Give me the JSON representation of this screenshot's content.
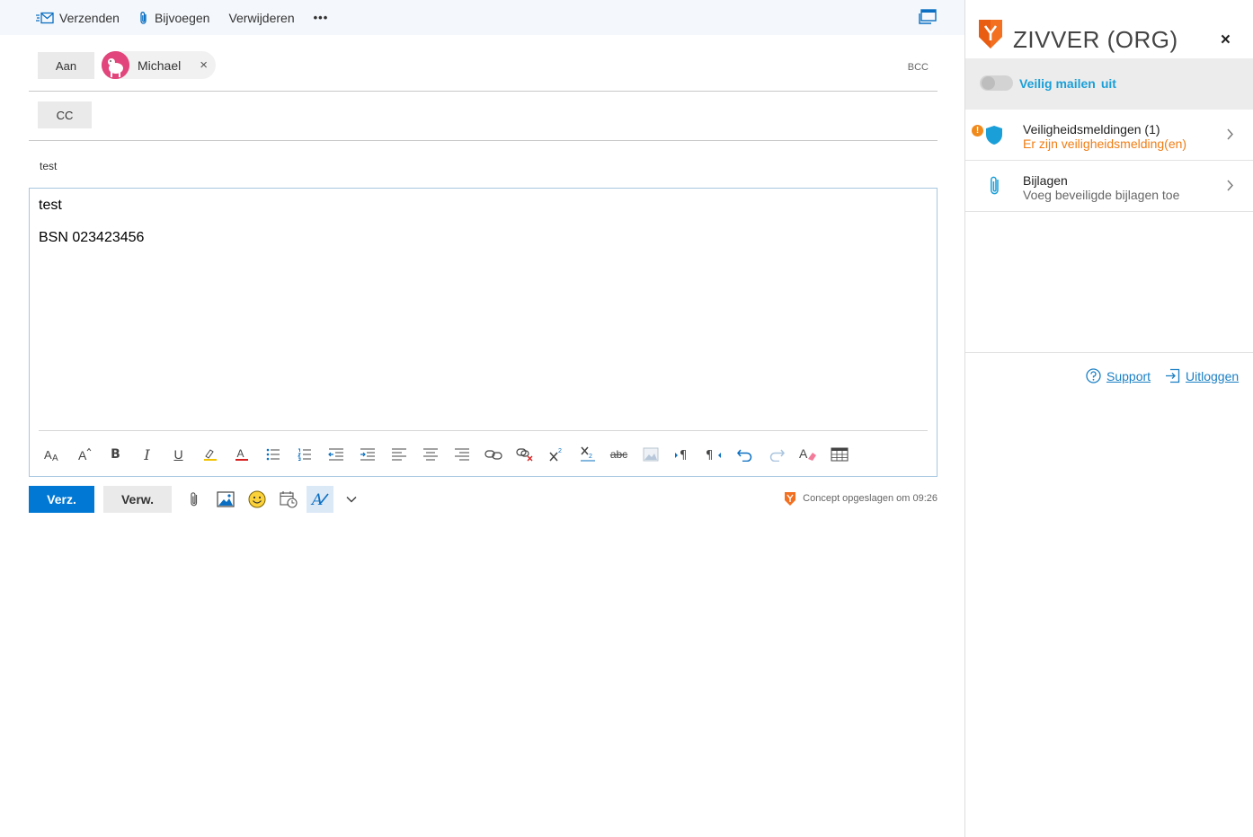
{
  "command_bar": {
    "send_label": "Verzenden",
    "attach_label": "Bijvoegen",
    "delete_label": "Verwijderen",
    "more_label": "•••"
  },
  "recipients": {
    "to_label": "Aan",
    "to_chips": [
      {
        "name": "Michael"
      }
    ],
    "remove_label": "×",
    "cc_label": "CC",
    "bcc_label": "BCC"
  },
  "subject": "test",
  "body": {
    "lines": [
      "test",
      "BSN 023423456"
    ]
  },
  "format_toolbar": {
    "icons": [
      "font-size-icon",
      "grow-font-icon",
      "bold-icon",
      "italic-icon",
      "underline-icon",
      "highlight-icon",
      "font-color-icon",
      "bullets-icon",
      "numbering-icon",
      "decrease-indent-icon",
      "increase-indent-icon",
      "align-left-icon",
      "align-center-icon",
      "align-right-icon",
      "insert-link-icon",
      "remove-link-icon",
      "superscript-icon",
      "subscript-icon",
      "strikethrough-icon",
      "insert-picture-icon",
      "ltr-icon",
      "rtl-icon",
      "undo-icon",
      "redo-icon",
      "clear-formatting-icon",
      "insert-table-icon"
    ],
    "strike_label": "abc"
  },
  "bottom_bar": {
    "send_label": "Verz.",
    "discard_label": "Verw.",
    "saved_status": "Concept opgeslagen om 09:26"
  },
  "zivver": {
    "title": "ZIVVER (ORG)",
    "close_label": "×",
    "secure_mail_label": "Veilig mailen",
    "secure_mail_state": "uit",
    "alerts": {
      "title": "Veiligheidsmeldingen (1)",
      "subtitle": "Er zijn veiligheidsmelding(en)",
      "badge": "!"
    },
    "attachments": {
      "title": "Bijlagen",
      "subtitle": "Voeg beveiligde bijlagen toe"
    },
    "support_label": "Support",
    "logout_label": "Uitloggen"
  },
  "colors": {
    "accent": "#0078d4",
    "zivver_orange": "#f07d14",
    "zivver_blue": "#1a9fd8"
  }
}
